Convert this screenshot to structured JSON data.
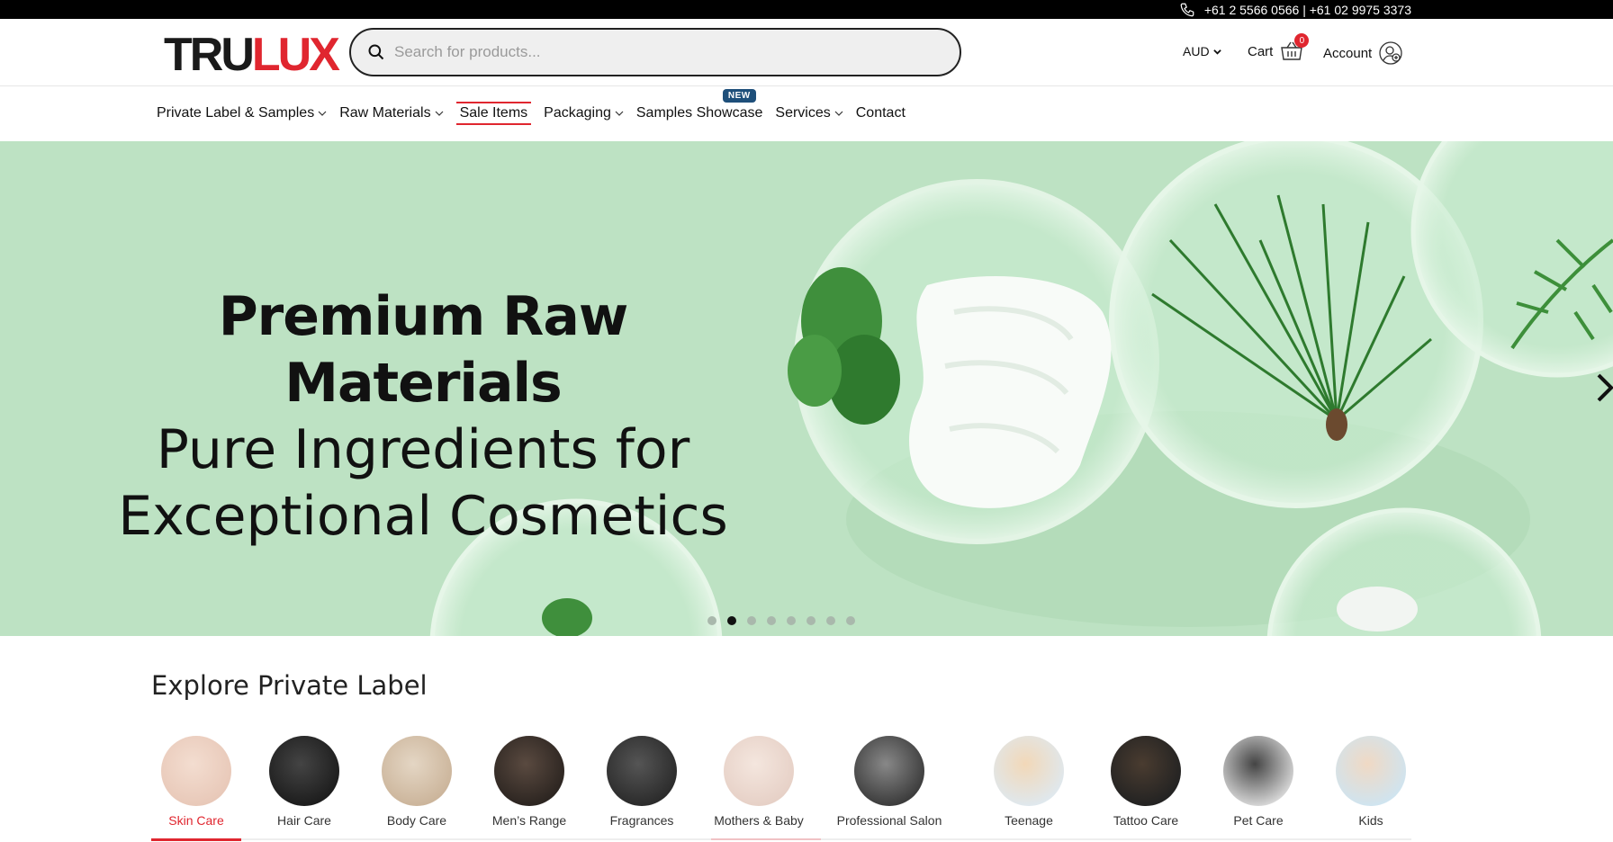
{
  "topbar": {
    "phones": "+61 2 5566 0566 | +61 02 9975 3373"
  },
  "header": {
    "logo_part1": "TRU",
    "logo_part2": "LUX",
    "search_placeholder": "Search for products...",
    "currency": "AUD",
    "cart_label": "Cart",
    "cart_count": "0",
    "account_label": "Account"
  },
  "nav": {
    "items": [
      {
        "label": "Private Label & Samples",
        "dropdown": true
      },
      {
        "label": "Raw Materials",
        "dropdown": true
      },
      {
        "label": "Sale Items",
        "dropdown": false
      },
      {
        "label": "Packaging",
        "dropdown": true
      },
      {
        "label": "Samples Showcase",
        "dropdown": false,
        "badge": "NEW"
      },
      {
        "label": "Services",
        "dropdown": true
      },
      {
        "label": "Contact",
        "dropdown": false
      }
    ]
  },
  "hero": {
    "line1": "Premium Raw Materials",
    "line2": "Pure Ingredients for",
    "line3": "Exceptional Cosmetics",
    "slide_count": 8,
    "active_slide": 2
  },
  "explore": {
    "title": "Explore Private Label",
    "categories": [
      {
        "label": "Skin Care",
        "active": true
      },
      {
        "label": "Hair Care"
      },
      {
        "label": "Body Care"
      },
      {
        "label": "Men’s Range"
      },
      {
        "label": "Fragrances"
      },
      {
        "label": "Mothers & Baby"
      },
      {
        "label": "Professional Salon"
      },
      {
        "label": "Teenage"
      },
      {
        "label": "Tattoo Care"
      },
      {
        "label": "Pet Care"
      },
      {
        "label": "Kids"
      }
    ]
  },
  "colors": {
    "brand_red": "#e0262f",
    "hero_green": "#bfe3c5",
    "badge_blue": "#1e4f7a"
  }
}
